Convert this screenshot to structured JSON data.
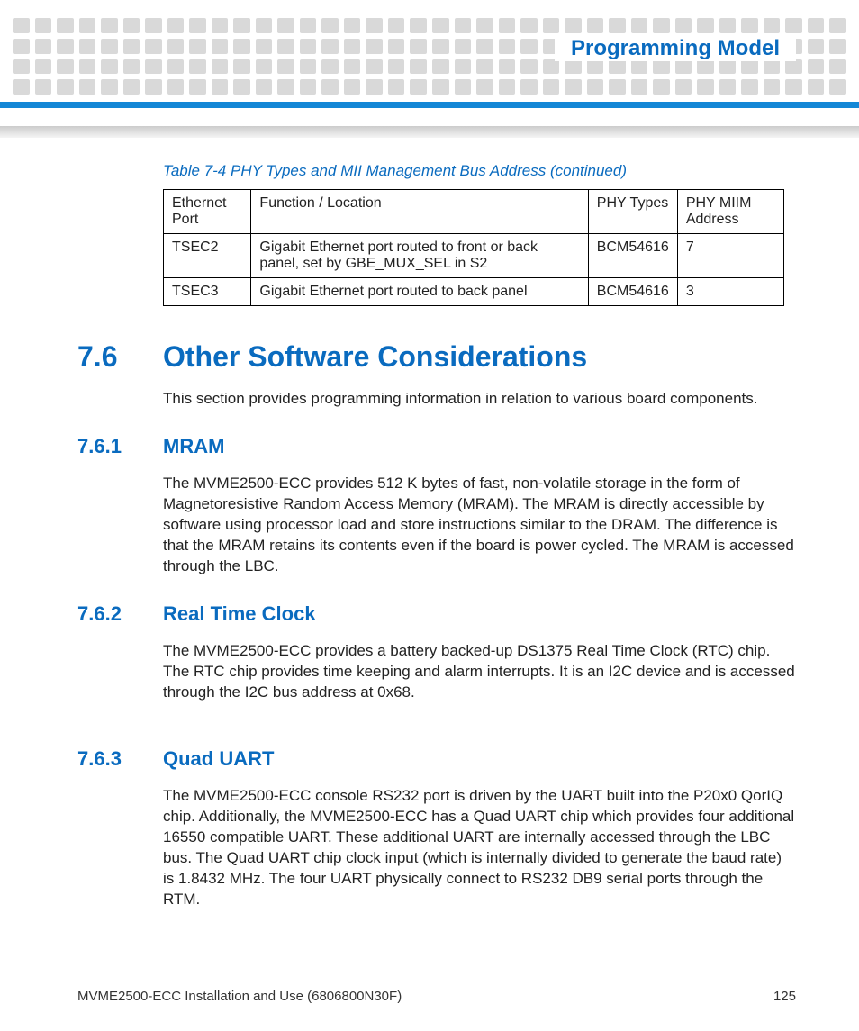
{
  "header": {
    "chapter_title": "Programming Model"
  },
  "table": {
    "caption": "Table 7-4 PHY Types and MII Management Bus Address (continued)",
    "columns": [
      "Ethernet Port",
      "Function / Location",
      "PHY Types",
      "PHY MIIM Address"
    ],
    "rows": [
      {
        "port": "TSEC2",
        "func": "Gigabit Ethernet port routed to front or back panel, set by GBE_MUX_SEL in S2",
        "type": "BCM54616",
        "addr": "7"
      },
      {
        "port": "TSEC3",
        "func": "Gigabit Ethernet port routed to back panel",
        "type": "BCM54616",
        "addr": "3"
      }
    ]
  },
  "sections": {
    "s76": {
      "num": "7.6",
      "title": "Other Software Considerations",
      "intro": "This section provides programming information in relation to various board components."
    },
    "s761": {
      "num": "7.6.1",
      "title": "MRAM",
      "body": "The MVME2500-ECC provides 512 K bytes of fast, non-volatile storage in the form of Magnetoresistive Random Access Memory (MRAM). The MRAM is directly accessible by software using processor load and store instructions similar to the DRAM. The difference is that the MRAM retains its contents even if the board is power cycled. The MRAM is accessed through the LBC."
    },
    "s762": {
      "num": "7.6.2",
      "title": "Real Time Clock",
      "body": "The MVME2500-ECC provides a battery backed-up DS1375 Real Time Clock (RTC) chip. The RTC chip provides time keeping and alarm interrupts. It is an I2C device and is accessed through the I2C bus address at 0x68."
    },
    "s763": {
      "num": "7.6.3",
      "title": "Quad UART",
      "body": "The MVME2500-ECC console RS232 port is driven by the UART built into the P20x0 QorIQ chip. Additionally, the MVME2500-ECC has a Quad UART chip which provides four additional 16550 compatible UART. These additional UART are internally accessed through the LBC bus. The Quad UART chip clock input (which is internally divided to generate the baud rate) is 1.8432 MHz. The four UART physically connect to RS232 DB9 serial ports through the RTM."
    }
  },
  "footer": {
    "doc_title": "MVME2500-ECC Installation and Use (6806800N30F)",
    "page_number": "125"
  }
}
